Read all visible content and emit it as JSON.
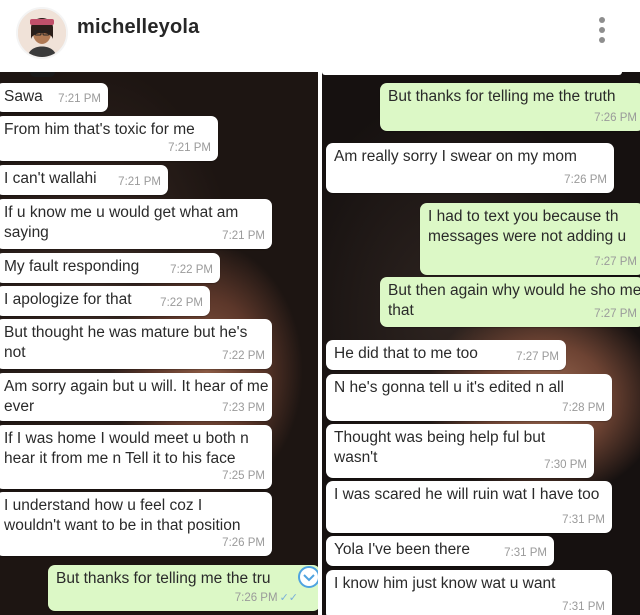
{
  "profile": {
    "username": "michelleyola",
    "avatar_icon": "avatar-icon",
    "menu_icon": "more-vertical-icon"
  },
  "left_chat": [
    {
      "text": "Sawa",
      "time": "7:21 PM",
      "dir": "in"
    },
    {
      "text": "From him that's toxic for me",
      "time": "7:21 PM",
      "dir": "in"
    },
    {
      "text": "I can't wallahi",
      "time": "7:21 PM",
      "dir": "in"
    },
    {
      "text": "If u know me u would get what am saying",
      "time": "7:21 PM",
      "dir": "in"
    },
    {
      "text": "My fault responding",
      "time": "7:22 PM",
      "dir": "in"
    },
    {
      "text": "I apologize for that",
      "time": "7:22 PM",
      "dir": "in"
    },
    {
      "text": "But thought he was mature but he's not",
      "time": "7:22 PM",
      "dir": "in"
    },
    {
      "text": "Am sorry again but u will. It hear of me ever",
      "time": "7:23 PM",
      "dir": "in"
    },
    {
      "text": "If I was home I would meet u both n hear it from me n Tell it to his face",
      "time": "7:25 PM",
      "dir": "in"
    },
    {
      "text": "I understand how u feel coz I wouldn't want to be in that position",
      "time": "7:26 PM",
      "dir": "in"
    },
    {
      "text": "But thanks for telling me the tru",
      "time": "7:26 PM",
      "dir": "out",
      "ticks": "✓✓"
    }
  ],
  "right_chat": [
    {
      "text": "But thanks for telling me the truth",
      "time": "7:26 PM",
      "dir": "out"
    },
    {
      "text": "Am really sorry I swear on my mom",
      "time": "7:26 PM",
      "dir": "in"
    },
    {
      "text": "I had to text you because th messages were not adding u",
      "time": "7:27 PM",
      "dir": "out"
    },
    {
      "text": "But then again why would he sho me that",
      "time": "7:27 PM",
      "dir": "out"
    },
    {
      "text": "He did that to me too",
      "time": "7:27 PM",
      "dir": "in"
    },
    {
      "text": "N he's gonna tell u it's edited n all",
      "time": "7:28 PM",
      "dir": "in"
    },
    {
      "text": "Thought was being help ful but wasn't",
      "time": "7:30 PM",
      "dir": "in"
    },
    {
      "text": "I was scared he will ruin wat I have too",
      "time": "7:31 PM",
      "dir": "in"
    },
    {
      "text": "Yola I've been there",
      "time": "7:31 PM",
      "dir": "in"
    },
    {
      "text": "I know him just know wat u want",
      "time": "7:31 PM",
      "dir": "in"
    }
  ],
  "colors": {
    "incoming": "#ffffff",
    "outgoing": "#dcf8c6",
    "timestamp": "#9a9a9a",
    "read_ticks": "#7ab0d9"
  }
}
